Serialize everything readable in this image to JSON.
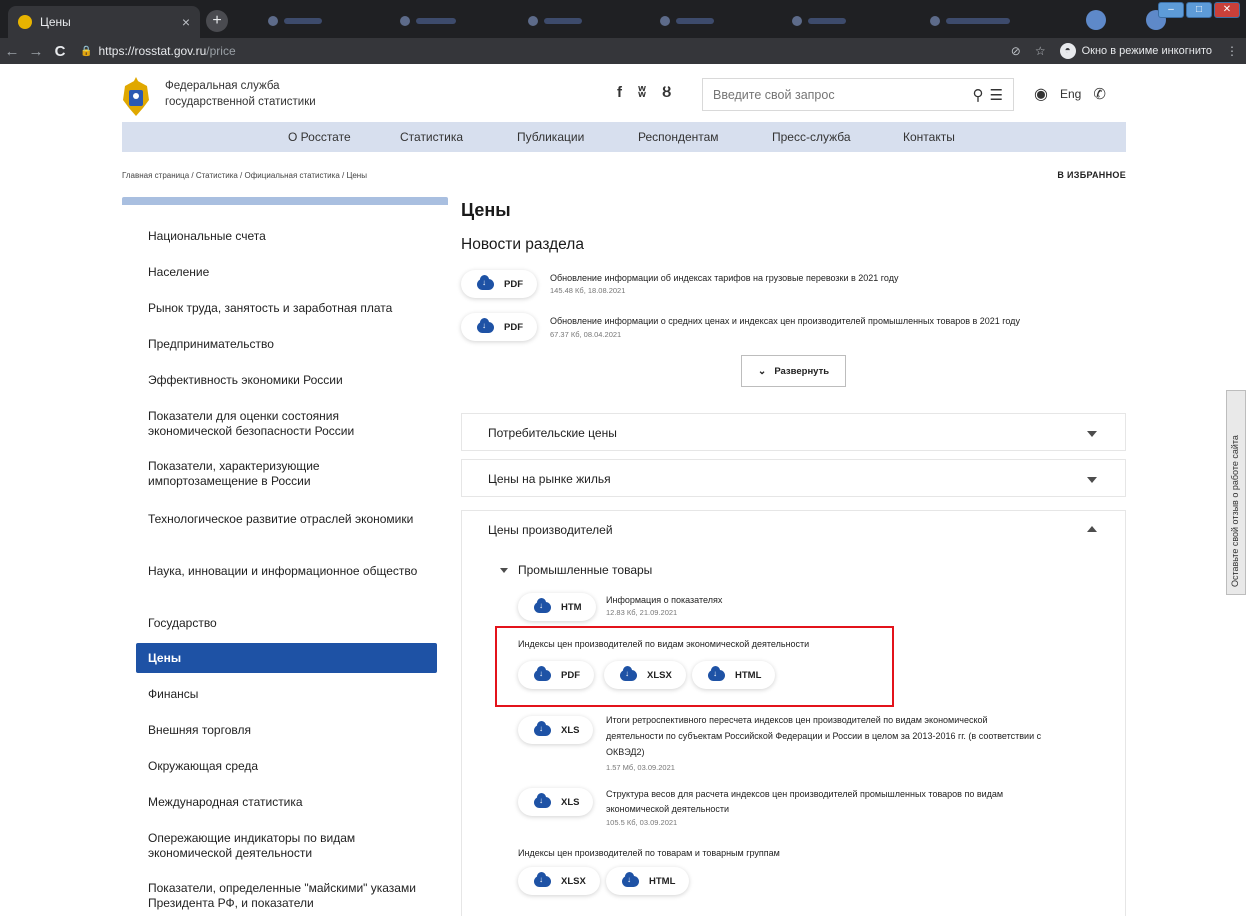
{
  "browser": {
    "tab_title": "Цены",
    "url_host": "https://rosstat.gov.ru",
    "url_path": "/price",
    "incognito_label": "Окно в режиме инкогнито"
  },
  "site": {
    "org_name_line1": "Федеральная служба",
    "org_name_line2": "государственной статистики",
    "search_placeholder": "Введите свой запрос",
    "lang_label": "Eng",
    "nav": [
      "О Росстате",
      "Статистика",
      "Публикации",
      "Респондентам",
      "Пресс-служба",
      "Контакты"
    ],
    "breadcrumb": "Главная страница / Статистика / Официальная статистика / Цены",
    "favorite_label": "В ИЗБРАННОЕ"
  },
  "sidebar": {
    "items": [
      "Национальные счета",
      "Население",
      "Рынок труда, занятость и заработная плата",
      "Предпринимательство",
      "Эффективность экономики России",
      "Показатели для оценки состояния экономической безопасности России",
      "Показатели, характеризующие импортозамещение в России",
      "Технологическое развитие отраслей экономики",
      "Наука, инновации и информационное общество",
      "Государство",
      "Цены",
      "Финансы",
      "Внешняя торговля",
      "Окружающая среда",
      "Международная статистика",
      "Опережающие индикаторы по видам экономической деятельности",
      "Показатели, определенные \"майскими\" указами Президента РФ, и показатели"
    ],
    "active": "Цены"
  },
  "main": {
    "title": "Цены",
    "news_heading": "Новости раздела",
    "news": [
      {
        "format": "PDF",
        "title": "Обновление информации об индексах тарифов на грузовые перевозки в 2021 году",
        "meta": "145.48 Кб, 18.08.2021"
      },
      {
        "format": "PDF",
        "title": "Обновление информации о средних ценах и индексах цен производителей промышленных товаров в 2021 году",
        "meta": "67.37 Кб, 08.04.2021"
      }
    ],
    "expand_label": "Развернуть",
    "sections": [
      "Потребительские цены",
      "Цены на рынке жилья",
      "Цены производителей"
    ],
    "subsection": "Промышленные товары",
    "files": {
      "info": {
        "format": "HTM",
        "title": "Информация о показателях",
        "meta": "12.83 Кб, 21.09.2021"
      },
      "ppi_by_activity": {
        "title": "Индексы цен производителей по видам экономической деятельности",
        "formats": [
          "PDF",
          "XLSX",
          "HTML"
        ]
      },
      "retro": {
        "format": "XLS",
        "title_l1": "Итоги ретроспективного пересчета индексов цен производителей по видам экономической",
        "title_l2": "деятельности по субъектам Российской Федерации и России в целом за 2013-2016 гг. (в соответствии с",
        "title_l3": "ОКВЭД2)",
        "meta": "1.57 Мб, 03.09.2021"
      },
      "weights": {
        "format": "XLS",
        "title_l1": "Структура весов для расчета индексов цен производителей промышленных товаров по видам",
        "title_l2": "экономической деятельности",
        "meta": "105.5 Кб, 03.09.2021"
      },
      "ppi_by_goods": {
        "title": "Индексы цен производителей по товарам и товарным группам",
        "formats": [
          "XLSX",
          "HTML"
        ]
      }
    }
  },
  "feedback_tab": "Оставьте свой отзыв о работе сайта",
  "colors": {
    "accent": "#1e52a5",
    "nav_bg": "#d7dfee",
    "highlight": "#e3131b"
  }
}
